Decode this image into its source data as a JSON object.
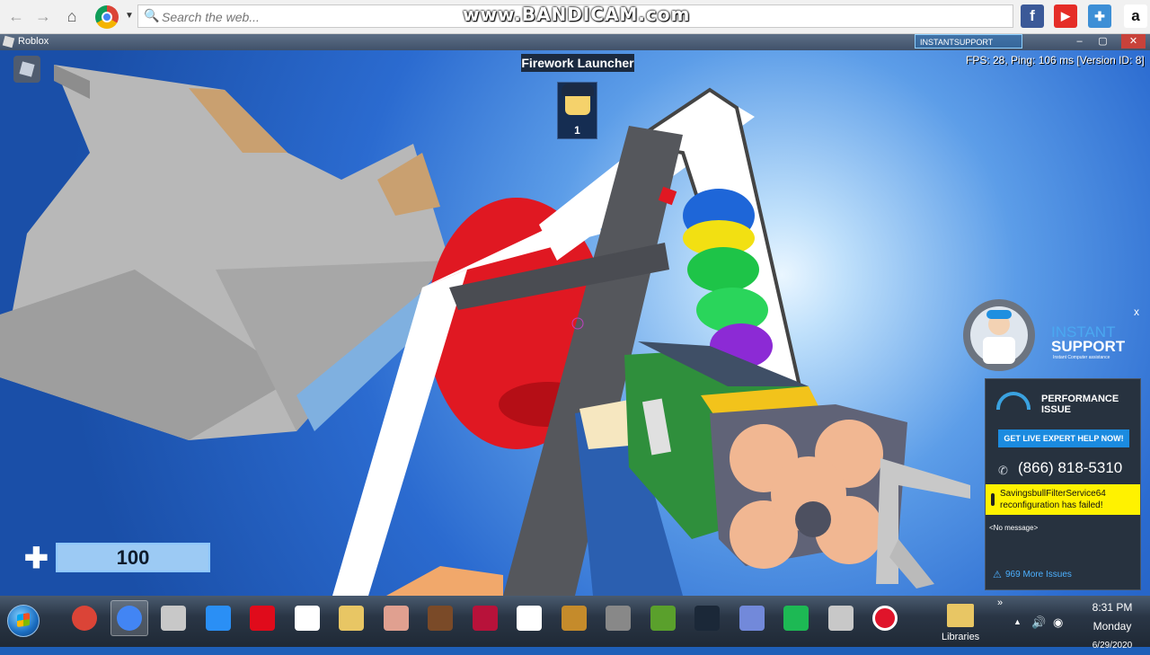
{
  "browser": {
    "search_placeholder": "Search the web...",
    "watermark": "www.BANDICAM.com",
    "extensions": [
      {
        "name": "facebook",
        "glyph": "f",
        "color": "#3b5998"
      },
      {
        "name": "youtube",
        "glyph": "▶",
        "color": "#e52d27"
      },
      {
        "name": "game-controller",
        "glyph": "🎮",
        "color": "#3d8fd6"
      },
      {
        "name": "amazon",
        "glyph": "a",
        "color": "#ffffff"
      }
    ]
  },
  "window": {
    "title": "Roblox",
    "instant_support_badge": "INSTANTSUPPORT",
    "controls": [
      "–",
      "▢",
      "✕"
    ]
  },
  "game": {
    "stats": "FPS: 28, Ping: 106 ms [Version ID: 8]",
    "tool_name": "Firework Launcher",
    "tool_slot": "1",
    "health": "100",
    "health_fraction": 1.0
  },
  "instant_support": {
    "logo_title_line1": "INSTANT",
    "logo_title_line2": "SUPPORT",
    "logo_subtitle": "Instant Computer assistance",
    "close": "x",
    "performance": "PERFORMANCE ISSUE",
    "cta": "GET LIVE EXPERT HELP NOW!",
    "phone": "(866) 818-5310",
    "alert": "SavingsbullFilterService64 reconfiguration has failed!",
    "message": "<No message>",
    "more_issues": "969 More Issues"
  },
  "taskbar": {
    "libraries_label": "Libraries",
    "time": "8:31 PM",
    "day": "Monday",
    "date": "6/29/2020",
    "items": [
      {
        "name": "chrome",
        "color": "#db4437"
      },
      {
        "name": "chrome-active",
        "color": "#4285f4"
      },
      {
        "name": "roblox-studio-1",
        "color": "#c8c8c8"
      },
      {
        "name": "roblox-studio-blue",
        "color": "#2a8ff5"
      },
      {
        "name": "opera",
        "color": "#e00b1b"
      },
      {
        "name": "blank-document",
        "color": "#ffffff"
      },
      {
        "name": "file-explorer",
        "color": "#e8c664"
      },
      {
        "name": "pig-game",
        "color": "#e0a090"
      },
      {
        "name": "fnaf",
        "color": "#7a4a28"
      },
      {
        "name": "game-red",
        "color": "#b8123a"
      },
      {
        "name": "notepad",
        "color": "#ffffff"
      },
      {
        "name": "brave-lion",
        "color": "#c58b2b"
      },
      {
        "name": "gear-app",
        "color": "#888888"
      },
      {
        "name": "minecraft",
        "color": "#5aa02c"
      },
      {
        "name": "steam",
        "color": "#1b2838"
      },
      {
        "name": "discord",
        "color": "#7289da"
      },
      {
        "name": "spotify",
        "color": "#1db954"
      },
      {
        "name": "roblox-player",
        "color": "#c8c8c8"
      },
      {
        "name": "bandicam-record",
        "color": "#e0142a"
      }
    ]
  }
}
